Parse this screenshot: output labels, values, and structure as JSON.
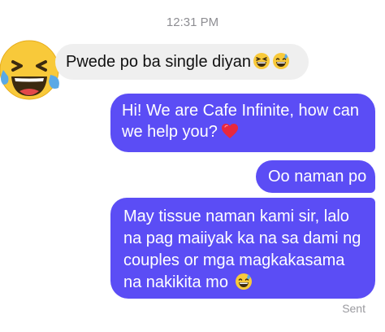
{
  "thread": {
    "timestamp": "12:31 PM",
    "status": "Sent"
  },
  "messages": [
    {
      "direction": "incoming",
      "text": "Pwede po ba single diyan",
      "emojis": [
        "grinning-squinting-face",
        "grinning-face-with-sweat"
      ]
    },
    {
      "direction": "outgoing",
      "lines": [
        "Hi! We are Cafe Infinite, how can",
        "we help you?"
      ],
      "emojis": [
        "red-heart"
      ]
    },
    {
      "direction": "outgoing",
      "text": "Oo naman po"
    },
    {
      "direction": "outgoing",
      "lines": [
        "May tissue naman kami sir, lalo",
        "na pag maiiyak ka na sa dami ng",
        "couples or mga magkakasama",
        "na nakikita mo"
      ],
      "emojis": [
        "grinning-face-with-sweat"
      ]
    }
  ],
  "avatar": {
    "icon": "laughing-tears-emoji-icon"
  },
  "colors": {
    "outgoing_bubble": "#5b4df5",
    "incoming_bubble": "#efefef",
    "meta_text": "#8e8e93"
  }
}
